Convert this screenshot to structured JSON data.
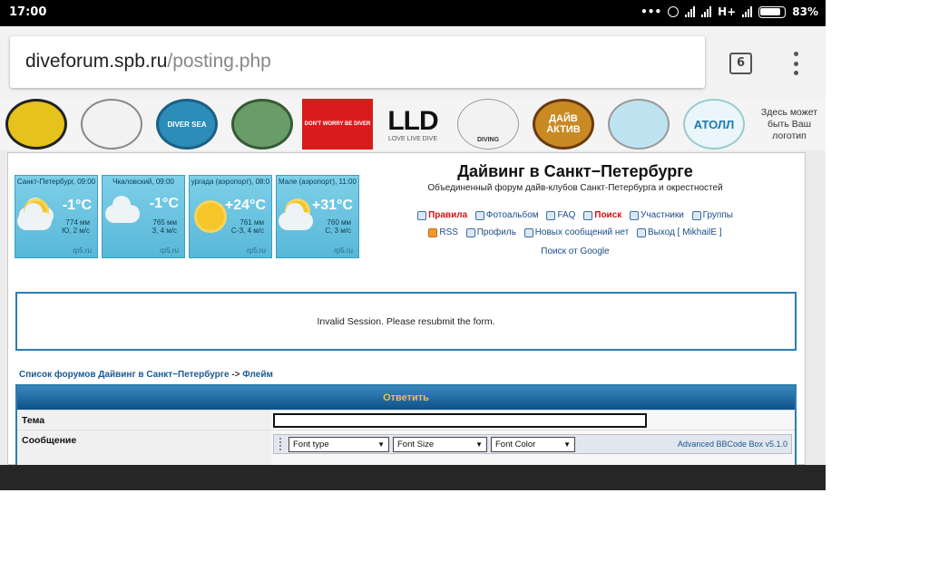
{
  "status": {
    "time": "17:00",
    "dots": "•••",
    "network": "H+",
    "battery": "83%"
  },
  "browser": {
    "host": "diveforum.spb.ru",
    "path": "/posting.php",
    "tab_count": "6"
  },
  "logos": [
    {
      "text": "",
      "color": "#e5c21c"
    },
    {
      "text": "",
      "color": "#f0f0f0"
    },
    {
      "text": "DIVER SEA",
      "color": "#2b8db8"
    },
    {
      "text": "",
      "color": "#6a9c6a"
    },
    {
      "text": "DON'T WORRY BE DIVER",
      "color": "#d81c1c"
    },
    {
      "text": "LLD",
      "sub": "LOVE LIVE DIVE",
      "color": "#ffffff"
    },
    {
      "text": "DIVING",
      "color": "#f0f0f0"
    },
    {
      "text": "ДАЙВ АКТИВ",
      "color": "#c98a24"
    },
    {
      "text": "",
      "color": "#bfe3f0"
    },
    {
      "text": "АТОЛЛ",
      "color": "#eaf6fb"
    }
  ],
  "logo_placeholder": "Здесь может быть Ваш логотип",
  "weather": [
    {
      "city": "Санкт-Петербург, 09:00",
      "temp": "-1°C",
      "line1": "774 мм",
      "line2": "Ю, 2 м/с",
      "icon": "sun-cloud-icon",
      "src": "rp5.ru"
    },
    {
      "city": "Чкаловский, 09:00",
      "temp": "-1°C",
      "line1": "765 мм",
      "line2": "З, 4 м/с",
      "icon": "cloud-icon",
      "src": "rp5.ru"
    },
    {
      "city": "ургада (аэропорт), 08:0",
      "temp": "+24°C",
      "line1": "761 мм",
      "line2": "С-З, 4 м/с",
      "icon": "sun-icon",
      "src": "rp5.ru"
    },
    {
      "city": "Мале (аэропорт), 11:00",
      "temp": "+31°C",
      "line1": "760 мм",
      "line2": "С, 3 м/с",
      "icon": "sun-cloud-icon",
      "src": "rp5.ru"
    }
  ],
  "site": {
    "title": "Дайвинг в Санкт−Петербурге",
    "subtitle": "Объединенный форум дайв-клубов Санкт-Петербурга и окрестностей"
  },
  "nav": {
    "rules": "Правила",
    "album": "Фотоальбом",
    "faq": "FAQ",
    "search": "Поиск",
    "members": "Участники",
    "groups": "Группы",
    "rss": "RSS",
    "profile": "Профиль",
    "no_new": "Новых сообщений нет",
    "logout": "Выход [ MikhailE ]",
    "google": "Поиск от Google"
  },
  "message": "Invalid Session. Please resubmit the form.",
  "breadcrumb": {
    "forum": "Список форумов Дайвинг в Санкт−Петербурге",
    "sep": "->",
    "topic": "Флейм"
  },
  "post": {
    "header": "Ответить",
    "subject_label": "Тема",
    "message_label": "Сообщение",
    "font_type": "Font type",
    "font_size": "Font Size",
    "font_color": "Font Color",
    "bbcode": "Advanced BBCode Box v5.1.0"
  }
}
